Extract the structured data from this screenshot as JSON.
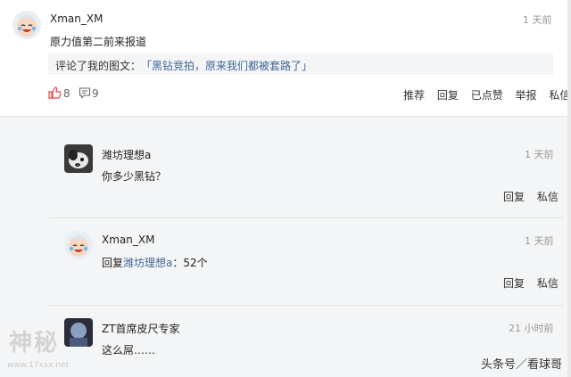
{
  "comment": {
    "username": "Xman_XM",
    "time": "1 天前",
    "text": "原力值第二前来报道",
    "quote_prefix": "评论了我的图文：",
    "quote_link": "「黑钻竞拍，原来我们都被套路了」",
    "likes": "8",
    "replies_count": "9",
    "actions": {
      "recommend": "推荐",
      "reply": "回复",
      "liked": "已点赞",
      "report": "举报",
      "message": "私信"
    }
  },
  "replies": [
    {
      "username": "潍坊理想a",
      "time": "1 天前",
      "text": "你多少黑钻？",
      "actions": {
        "reply": "回复",
        "message": "私信"
      }
    },
    {
      "username": "Xman_XM",
      "time": "1 天前",
      "reply_prefix": "回复",
      "reply_target": "潍坊理想a",
      "reply_text": "：52个",
      "actions": {
        "reply": "回复",
        "message": "私信"
      }
    },
    {
      "username": "ZT首席皮尺专家",
      "time": "21 小时前",
      "text": "这么屌……"
    }
  ],
  "watermark": {
    "left": "神秘",
    "left_url": "www.17xxx.net",
    "right": "头条号／看球哥"
  },
  "colors": {
    "link": "#406599",
    "like_red": "#f04142",
    "background": "#f4f5f6"
  }
}
